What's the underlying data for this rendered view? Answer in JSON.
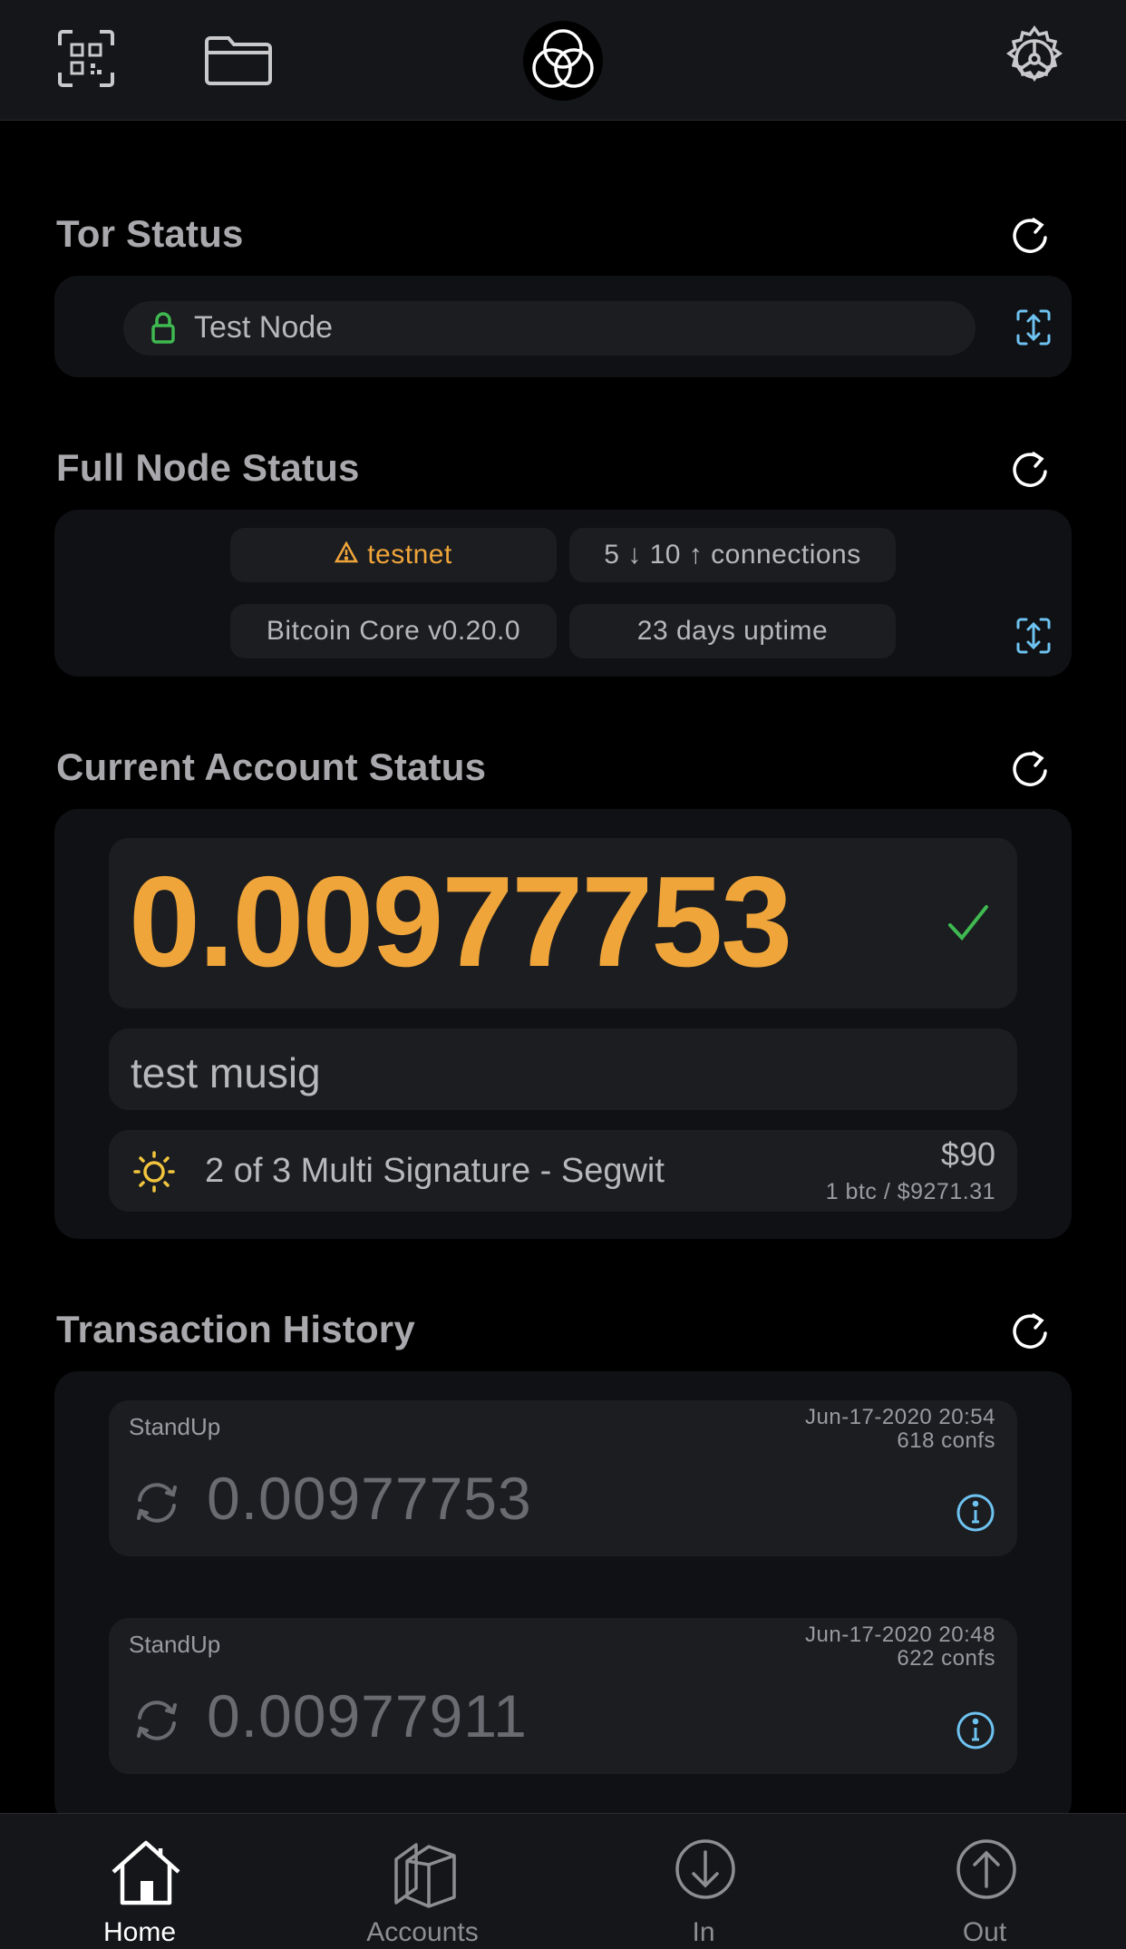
{
  "header": {
    "icons": [
      "qr-scan-icon",
      "folder-icon",
      "logo-rings-icon",
      "gear-icon"
    ]
  },
  "tor": {
    "title": "Tor Status",
    "node_label": "Test Node"
  },
  "full_node": {
    "title": "Full Node Status",
    "network": "testnet",
    "connections": "5 ↓ 10 ↑ connections",
    "version": "Bitcoin Core v0.20.0",
    "uptime": "23 days uptime"
  },
  "account": {
    "title": "Current Account Status",
    "balance": "0.00977753",
    "name": "test musig",
    "type": "2 of 3 Multi Signature - Segwit",
    "fiat": "$90",
    "rate": "1 btc / $9271.31"
  },
  "history": {
    "title": "Transaction History",
    "items": [
      {
        "label": "StandUp",
        "date": "Jun-17-2020 20:54",
        "confs": "618 confs",
        "amount": "0.00977753"
      },
      {
        "label": "StandUp",
        "date": "Jun-17-2020 20:48",
        "confs": "622 confs",
        "amount": "0.00977911"
      }
    ]
  },
  "tabs": [
    {
      "label": "Home",
      "active": true
    },
    {
      "label": "Accounts",
      "active": false
    },
    {
      "label": "In",
      "active": false
    },
    {
      "label": "Out",
      "active": false
    }
  ],
  "colors": {
    "accent_orange": "#f0a53a",
    "green_check": "#3fb950",
    "info_blue": "#6ec2f0",
    "background": "#000000"
  }
}
